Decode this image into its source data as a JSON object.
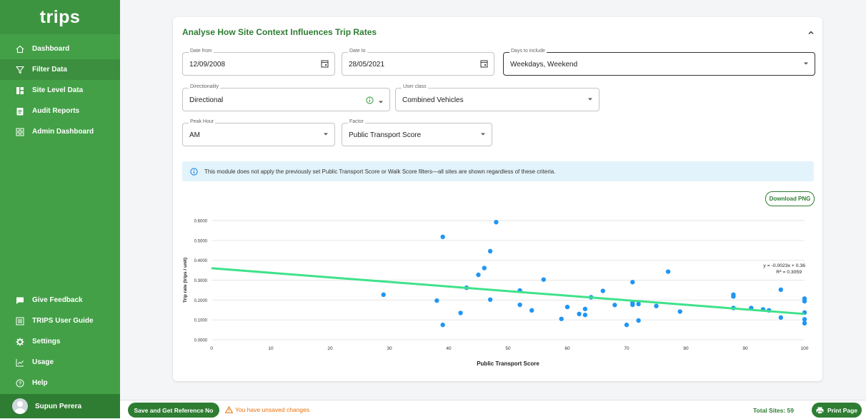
{
  "app": {
    "logo": "trips"
  },
  "sidebar": {
    "items": [
      {
        "label": "Dashboard",
        "icon": "home-icon"
      },
      {
        "label": "Filter Data",
        "icon": "filter-icon",
        "active": true
      },
      {
        "label": "Site Level Data",
        "icon": "site-data-icon"
      },
      {
        "label": "Audit Reports",
        "icon": "report-icon"
      },
      {
        "label": "Admin Dashboard",
        "icon": "admin-grid-icon"
      }
    ],
    "bottom_items": [
      {
        "label": "Give Feedback",
        "icon": "feedback-icon"
      },
      {
        "label": "TRIPS User Guide",
        "icon": "guide-icon"
      },
      {
        "label": "Settings",
        "icon": "gear-icon"
      },
      {
        "label": "Usage",
        "icon": "usage-chart-icon"
      },
      {
        "label": "Help",
        "icon": "help-icon"
      }
    ],
    "user": {
      "name": "Supun Perera"
    }
  },
  "panel": {
    "title": "Analyse How Site Context Influences Trip Rates",
    "fields": {
      "date_from": {
        "label": "Date from",
        "value": "12/09/2008"
      },
      "date_to": {
        "label": "Date to",
        "value": "28/05/2021"
      },
      "days": {
        "label": "Days to include",
        "value": "Weekdays, Weekend"
      },
      "directionality": {
        "label": "Directionality",
        "value": "Directional"
      },
      "user_class": {
        "label": "User class",
        "value": "Combined Vehicles"
      },
      "peak_hour": {
        "label": "Peak Hour",
        "value": "AM"
      },
      "factor": {
        "label": "Factor",
        "value": "Public Transport Score"
      }
    },
    "info": "This module does not apply the previously set Public Transport Score or Walk Score filters—all sites are shown regardless of these criteria.",
    "download_label": "Download PNG"
  },
  "chart_data": {
    "type": "scatter",
    "xlabel": "Public Transport Score",
    "ylabel": "Trip rate (trips / unit)",
    "xlim": [
      0,
      100
    ],
    "ylim": [
      0,
      0.6
    ],
    "xticks": [
      0,
      10,
      20,
      30,
      40,
      50,
      60,
      70,
      80,
      90,
      100
    ],
    "yticks": [
      "0.0000",
      "0.1000",
      "0.2000",
      "0.3000",
      "0.4000",
      "0.5000",
      "0.6000"
    ],
    "grid": true,
    "point_color": "#2196f3",
    "trend_color": "#3ee28a",
    "trendline": {
      "slope": -0.0023,
      "intercept": 0.36
    },
    "equation": "y = -0.0023x + 0.36",
    "r2": "R² = 0.3059",
    "points": [
      [
        29,
        0.227
      ],
      [
        38,
        0.197
      ],
      [
        39,
        0.518
      ],
      [
        39,
        0.075
      ],
      [
        42,
        0.135
      ],
      [
        43,
        0.262
      ],
      [
        45,
        0.327
      ],
      [
        46,
        0.361
      ],
      [
        47,
        0.446
      ],
      [
        47,
        0.202
      ],
      [
        48,
        0.592
      ],
      [
        52,
        0.248
      ],
      [
        52,
        0.176
      ],
      [
        54,
        0.148
      ],
      [
        56,
        0.303
      ],
      [
        59,
        0.105
      ],
      [
        60,
        0.165
      ],
      [
        62,
        0.13
      ],
      [
        63,
        0.155
      ],
      [
        63,
        0.125
      ],
      [
        64,
        0.214
      ],
      [
        66,
        0.246
      ],
      [
        68,
        0.175
      ],
      [
        70,
        0.075
      ],
      [
        71,
        0.29
      ],
      [
        71,
        0.186
      ],
      [
        71,
        0.176
      ],
      [
        72,
        0.18
      ],
      [
        72,
        0.097
      ],
      [
        75,
        0.17
      ],
      [
        77,
        0.343
      ],
      [
        79,
        0.142
      ],
      [
        88,
        0.227
      ],
      [
        88,
        0.218
      ],
      [
        88,
        0.16
      ],
      [
        91,
        0.16
      ],
      [
        93,
        0.153
      ],
      [
        94,
        0.148
      ],
      [
        96,
        0.252
      ],
      [
        96,
        0.112
      ],
      [
        100,
        0.207
      ],
      [
        100,
        0.194
      ],
      [
        100,
        0.137
      ],
      [
        100,
        0.103
      ],
      [
        100,
        0.083
      ]
    ]
  },
  "footer": {
    "save_label": "Save and Get Reference No",
    "unsaved": "You have unsaved changes",
    "total_sites": "Total Sites: 59",
    "print_label": "Print Page"
  }
}
